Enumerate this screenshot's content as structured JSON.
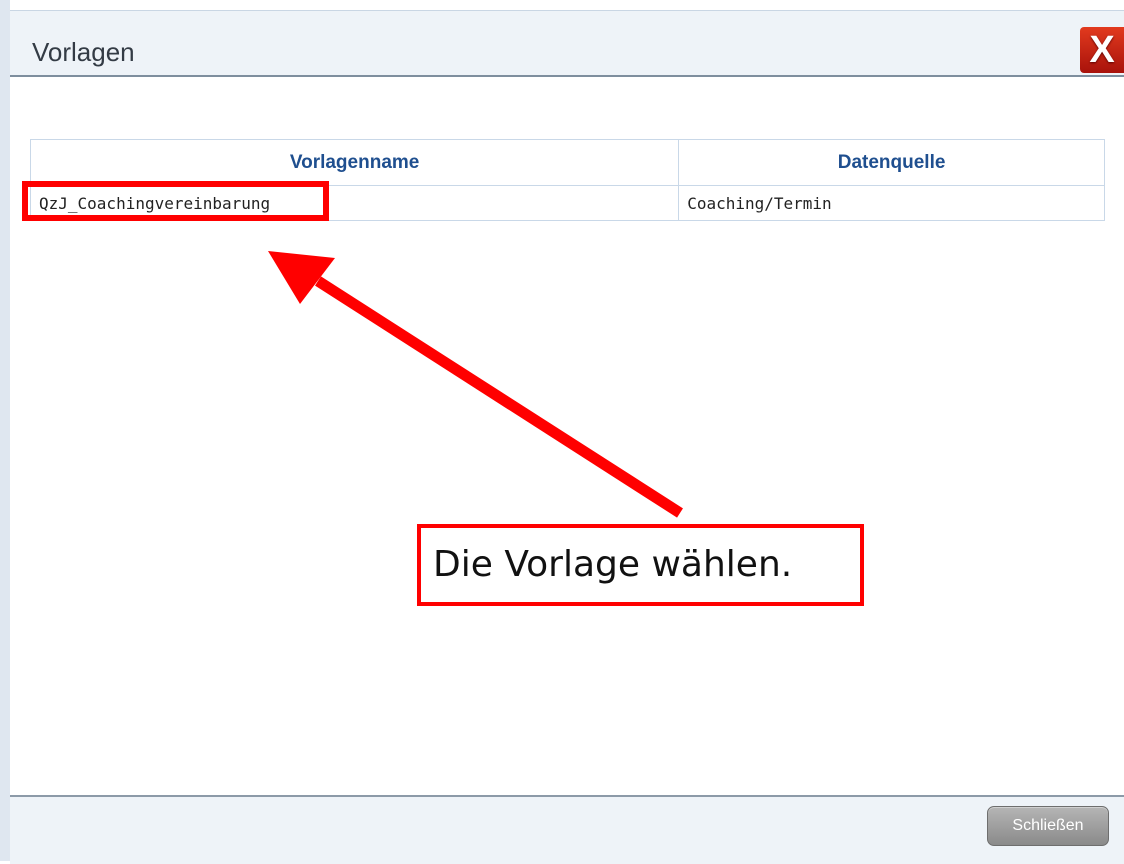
{
  "dialog": {
    "title": "Vorlagen",
    "close_icon_label": "X"
  },
  "table": {
    "headers": [
      "Vorlagenname",
      "Datenquelle"
    ],
    "rows": [
      [
        "QzJ_Coachingvereinbarung",
        "Coaching/Termin"
      ]
    ]
  },
  "annotation": {
    "callout_text": "Die Vorlage wählen.",
    "color": "#ff0000"
  },
  "footer": {
    "close_button_label": "Schließen"
  }
}
